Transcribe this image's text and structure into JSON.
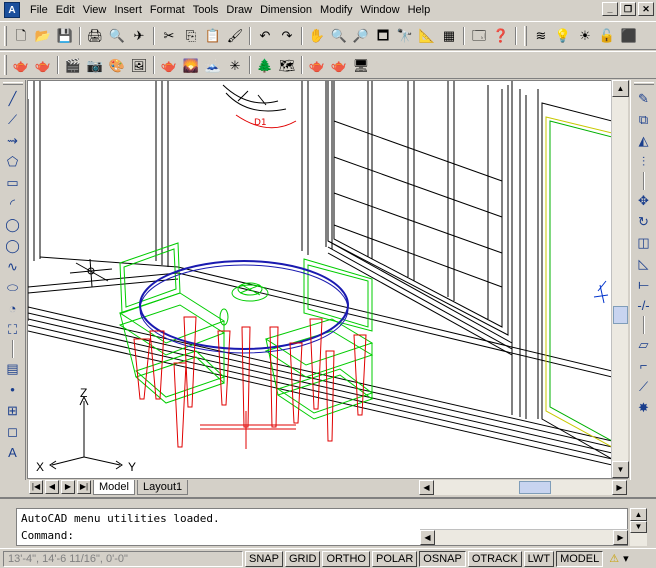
{
  "menus": [
    "File",
    "Edit",
    "View",
    "Insert",
    "Format",
    "Tools",
    "Draw",
    "Dimension",
    "Modify",
    "Window",
    "Help"
  ],
  "window_controls": [
    "_",
    "❐",
    "✕"
  ],
  "toolbar_standard": [
    "🗋",
    "📂",
    "💾",
    "🖨",
    "🔍",
    "✈",
    "✂",
    "⎘",
    "📋",
    "🖌",
    "↶",
    "↷",
    "✋",
    "🔍",
    "🔎",
    "🗖",
    "🔭",
    "📐",
    "▦",
    "🗔",
    "❓"
  ],
  "toolbar_layer": [
    "≋",
    "💡",
    "☀",
    "🔓",
    "⬛"
  ],
  "toolbar_render": [
    "🫖",
    "🫖",
    "🎬",
    "📷",
    "🎨",
    "🖼",
    "🫖",
    "🌄",
    "🗻",
    "✳",
    "🌲",
    "🗺",
    "🫖",
    "🫖",
    "🖥"
  ],
  "left_palette": [
    "╱",
    "⟋",
    "⇝",
    "⬠",
    "▭",
    "◜",
    "◯",
    "◯",
    "∿",
    "⬭",
    "◔",
    "⛶",
    "▤",
    "•",
    "⊞",
    "◻",
    "A"
  ],
  "right_palette": [
    "✎",
    "⧉",
    "◭",
    "⫶",
    "✥",
    "↻",
    "◫",
    "◺",
    "⟝",
    "-/-",
    "▱",
    "⌐",
    "⟋",
    "✸"
  ],
  "tabs": [
    {
      "label": "Model",
      "active": true
    },
    {
      "label": "Layout1",
      "active": false
    }
  ],
  "command": {
    "history_line": "AutoCAD menu utilities loaded.",
    "prompt": "Command:",
    "value": ""
  },
  "status": {
    "coords": "13'-4\", 14'-6 11/16\", 0'-0\"",
    "buttons": [
      {
        "label": "SNAP",
        "on": false
      },
      {
        "label": "GRID",
        "on": false
      },
      {
        "label": "ORTHO",
        "on": false
      },
      {
        "label": "POLAR",
        "on": false
      },
      {
        "label": "OSNAP",
        "on": true
      },
      {
        "label": "OTRACK",
        "on": false
      },
      {
        "label": "LWT",
        "on": false
      },
      {
        "label": "MODEL",
        "on": true
      }
    ]
  },
  "ucs": {
    "x": "X",
    "y": "Y",
    "z": "Z"
  },
  "colors": {
    "frame": "#000000",
    "chairs": "#00cc00",
    "table_legs": "#e00000",
    "table_top": "#1a1ab0",
    "wall_trim": "#ffff80"
  }
}
